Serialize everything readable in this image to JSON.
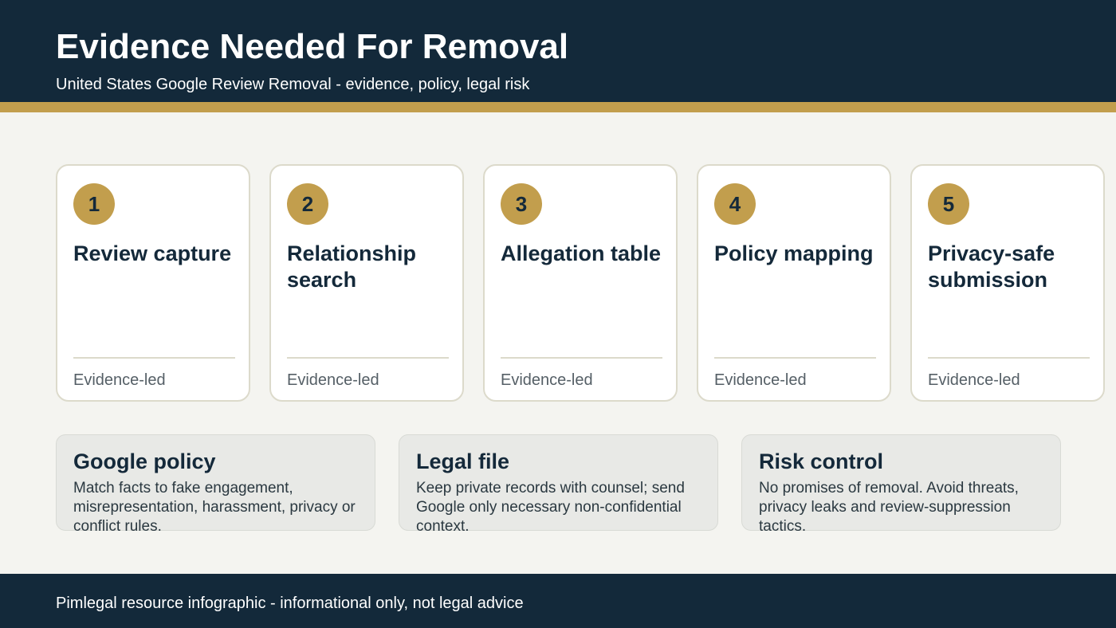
{
  "header": {
    "title": "Evidence Needed For Removal",
    "subtitle": "United States Google Review Removal - evidence, policy, legal risk"
  },
  "steps": [
    {
      "number": "1",
      "title": "Review capture",
      "footer": "Evidence-led"
    },
    {
      "number": "2",
      "title": "Relationship search",
      "footer": "Evidence-led"
    },
    {
      "number": "3",
      "title": "Allegation table",
      "footer": "Evidence-led"
    },
    {
      "number": "4",
      "title": "Policy mapping",
      "footer": "Evidence-led"
    },
    {
      "number": "5",
      "title": "Privacy-safe submission",
      "footer": "Evidence-led"
    }
  ],
  "info_cards": [
    {
      "title": "Google policy",
      "text": "Match facts to fake engagement, misrepresentation, harassment, privacy or conflict rules."
    },
    {
      "title": "Legal file",
      "text": "Keep private records with counsel; send Google only necessary non-confidential context."
    },
    {
      "title": "Risk control",
      "text": "No promises of removal. Avoid threats, privacy leaks and review-suppression tactics."
    }
  ],
  "footer": {
    "text": "Pimlegal resource infographic - informational only, not legal advice"
  },
  "colors": {
    "navy": "#13293a",
    "gold": "#c29e4d",
    "background": "#f4f4f0"
  }
}
